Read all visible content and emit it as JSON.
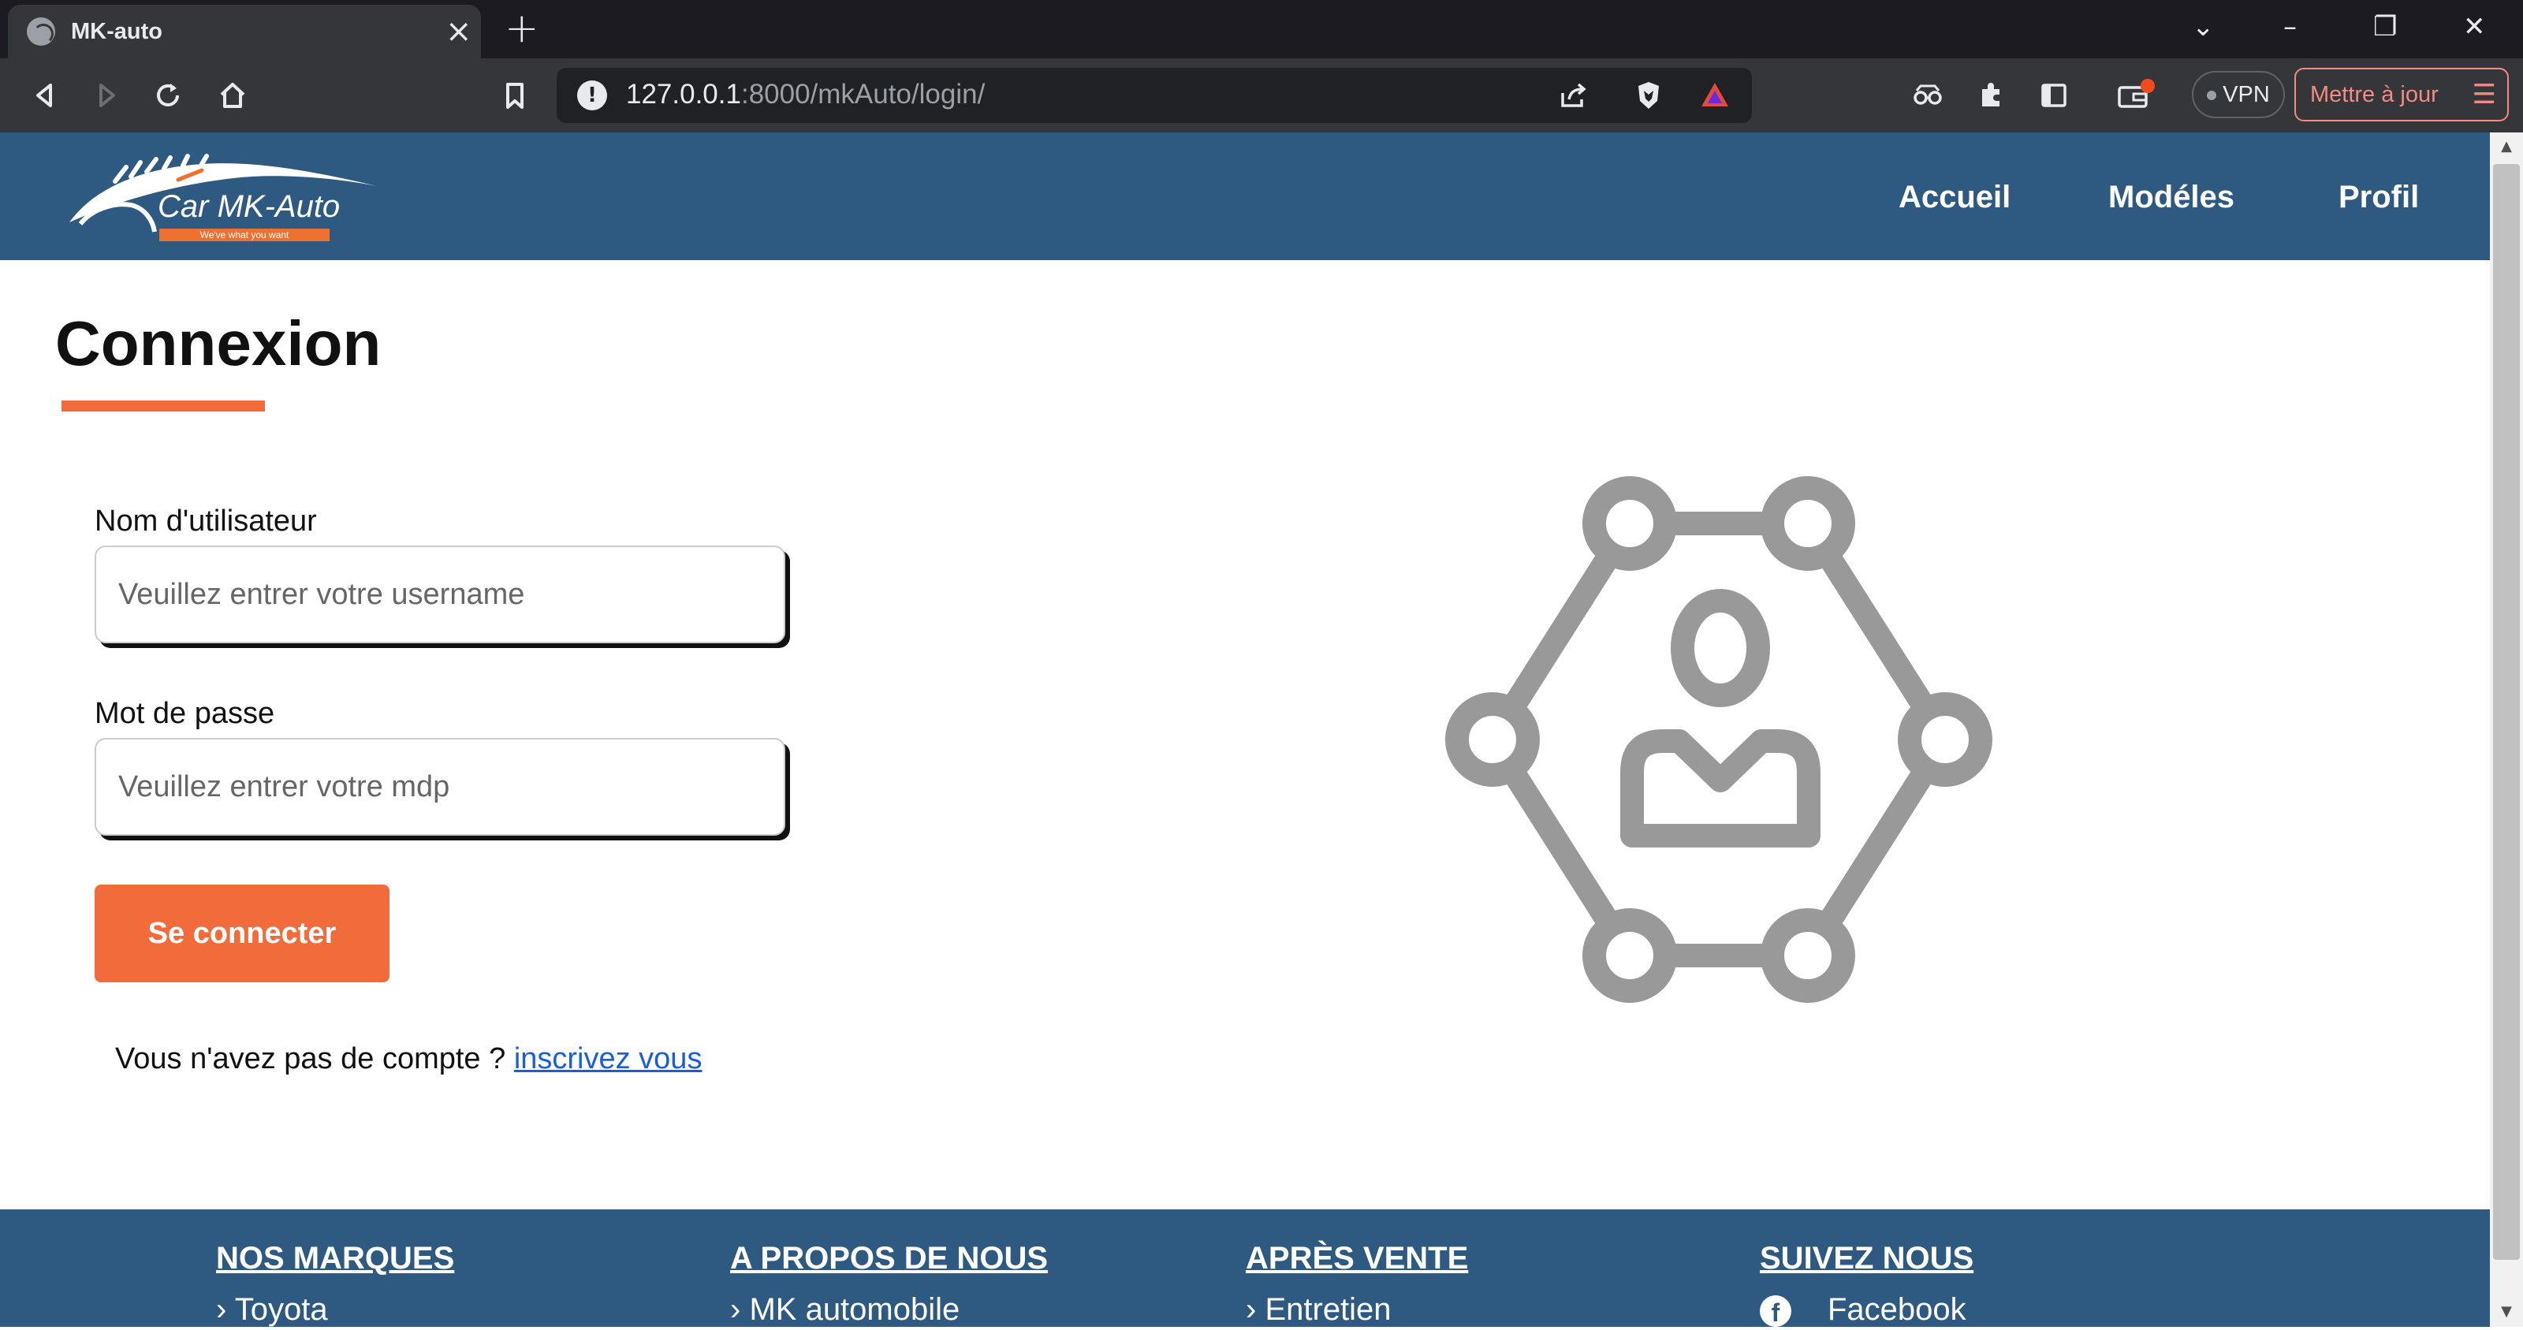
{
  "browser": {
    "tab_title": "MK-auto",
    "url_host": "127.0.0.1",
    "url_path": ":8000/mkAuto/login/",
    "vpn_label": "VPN",
    "update_label": "Mettre à jour"
  },
  "header": {
    "logo_text": "Car  MK-Auto",
    "logo_tagline": "We've what you want",
    "nav": [
      {
        "label": "Accueil"
      },
      {
        "label": "Modéles"
      },
      {
        "label": "Profil"
      }
    ]
  },
  "login": {
    "title": "Connexion",
    "username_label": "Nom d'utilisateur",
    "username_placeholder": "Veuillez entrer votre username",
    "password_label": "Mot de passe",
    "password_placeholder": "Veuillez entrer votre mdp",
    "submit_label": "Se connecter",
    "signup_prompt": "Vous n'avez pas de compte ?",
    "signup_link": "inscrivez vous"
  },
  "footer": {
    "columns": [
      {
        "heading": "NOS MARQUES",
        "item": "Toyota"
      },
      {
        "heading": "A PROPOS DE NOUS",
        "item": "MK automobile"
      },
      {
        "heading": "APRÈS VENTE",
        "item": "Entretien"
      },
      {
        "heading": "SUIVEZ NOUS",
        "item": "Facebook"
      }
    ]
  },
  "colors": {
    "header_bg": "#2e5a82",
    "accent": "#f26b3a",
    "link": "#1a5fd6"
  }
}
